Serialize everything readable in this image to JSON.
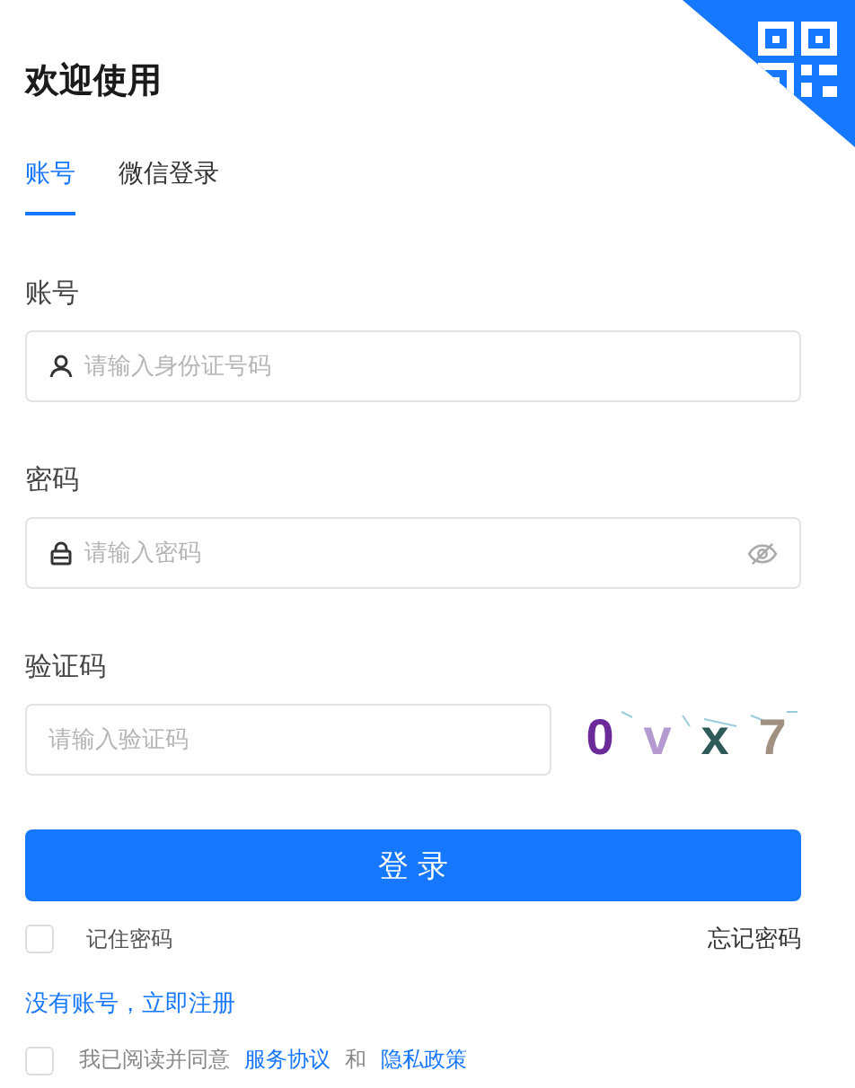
{
  "title": "欢迎使用",
  "tabs": [
    {
      "label": "账号",
      "selected": true
    },
    {
      "label": "微信登录",
      "selected": false
    }
  ],
  "fields": [
    {
      "kind": "account",
      "label": "账号",
      "placeholder": "请输入身份证号码"
    },
    {
      "kind": "password",
      "label": "密码",
      "placeholder": "请输入密码"
    },
    {
      "kind": "captcha",
      "label": "验证码",
      "placeholder": "请输入验证码",
      "captcha": [
        {
          "char": "0",
          "color": "#6a2a9a"
        },
        {
          "char": "v",
          "color": "#b49ad0"
        },
        {
          "char": "x",
          "color": "#2f5a5a"
        },
        {
          "char": "7",
          "color": "#a09080"
        }
      ]
    }
  ],
  "login_button": "登 录",
  "remember": {
    "label": "记住密码",
    "checked": false
  },
  "forgot_link": "忘记密码",
  "register_link": "没有账号，立即注册",
  "agreement": {
    "checked": false,
    "text": "我已阅读并同意",
    "link_1": "服务协议",
    "joiner": "和",
    "link_2": "隐私政策"
  }
}
